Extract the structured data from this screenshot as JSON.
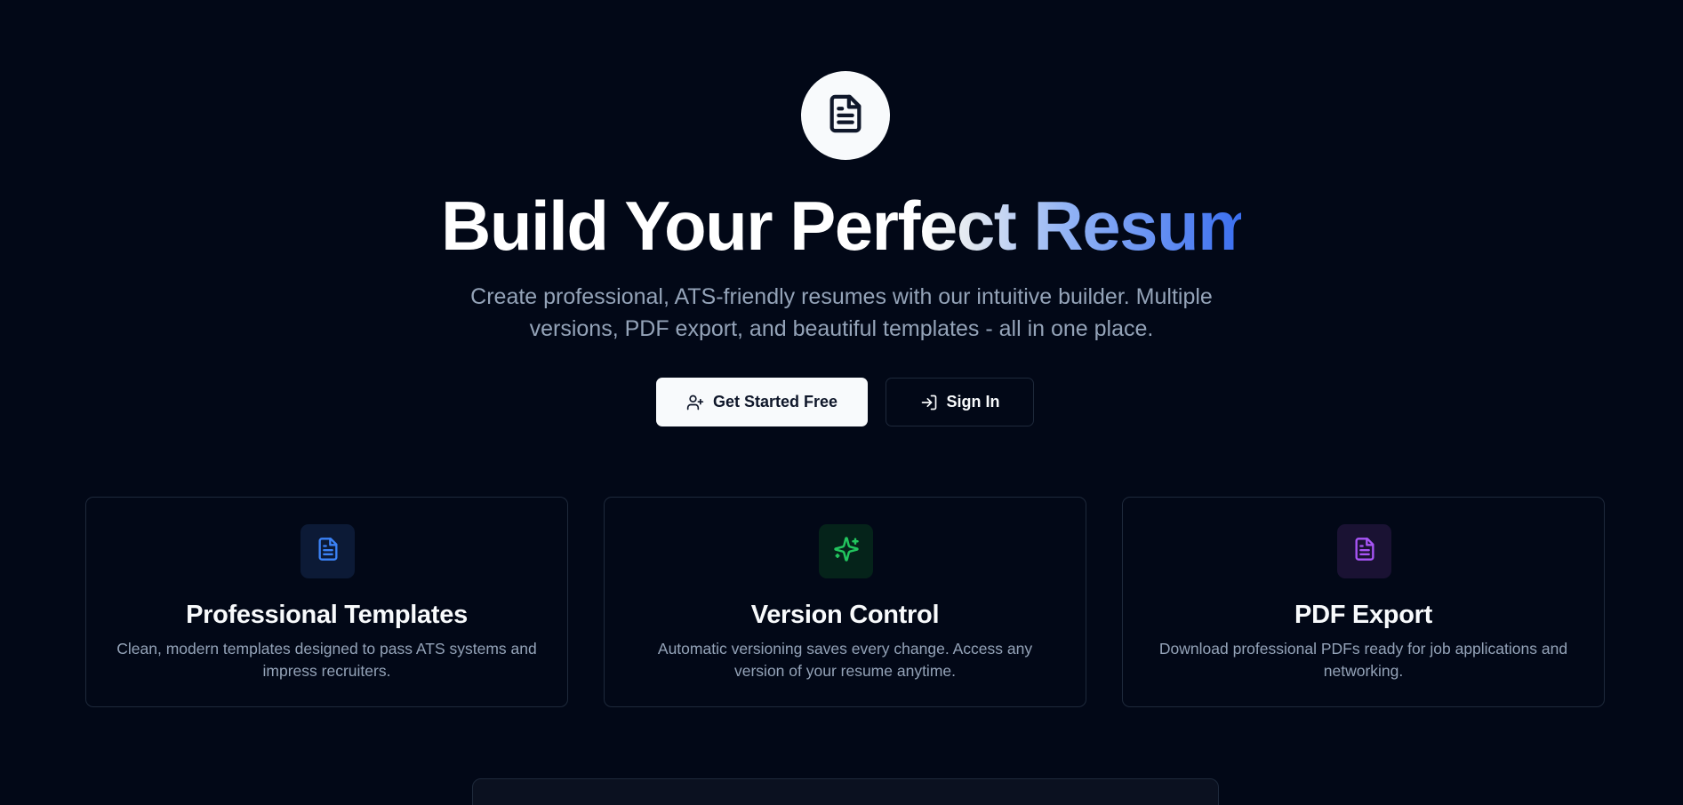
{
  "hero": {
    "title": "Build Your Perfect Resume",
    "subtitle": "Create professional, ATS-friendly resumes with our intuitive builder. Multiple versions, PDF export, and beautiful templates - all in one place.",
    "logo_icon": "file-text-icon"
  },
  "actions": {
    "primary_label": "Get Started Free",
    "primary_icon": "user-plus-icon",
    "secondary_label": "Sign In",
    "secondary_icon": "log-in-icon"
  },
  "features": [
    {
      "title": "Professional Templates",
      "description": "Clean, modern templates designed to pass ATS systems and impress recruiters.",
      "icon": "file-text-icon",
      "accent": "#3b82f6",
      "icon_bg": "#0c1a36"
    },
    {
      "title": "Version Control",
      "description": "Automatic versioning saves every change. Access any version of your resume anytime.",
      "icon": "sparkles-icon",
      "accent": "#22c55e",
      "icon_bg": "#05231a"
    },
    {
      "title": "PDF Export",
      "description": "Download professional PDFs ready for job applications and networking.",
      "icon": "file-text-icon",
      "accent": "#a855f7",
      "icon_bg": "#1a1233"
    }
  ],
  "colors": {
    "background": "#020817",
    "border": "#1e293b",
    "muted_text": "#94a3b8",
    "gradient_end": "#3b6ff0"
  }
}
